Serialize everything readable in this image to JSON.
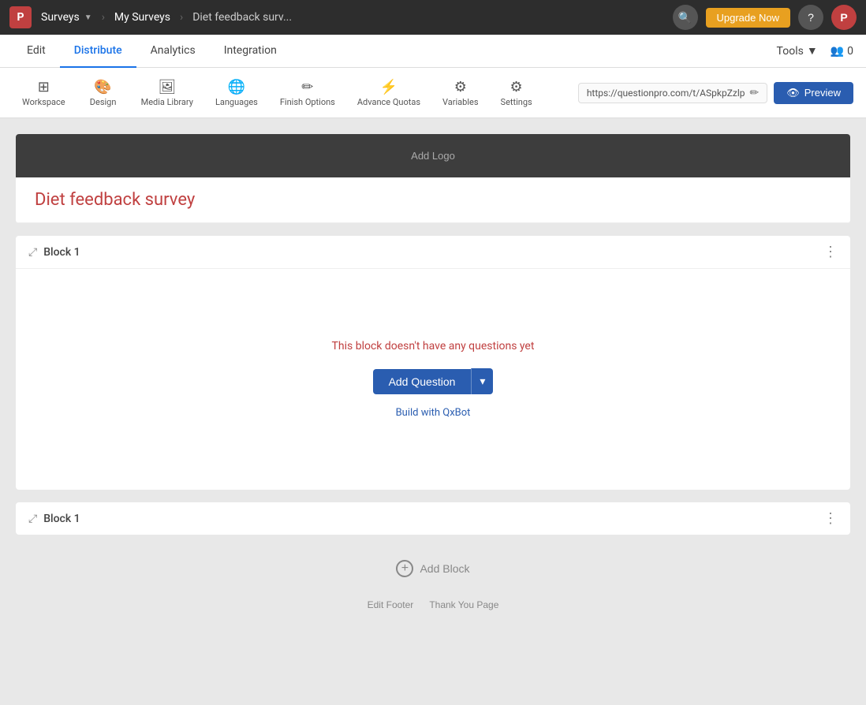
{
  "topbar": {
    "logo_text": "P",
    "surveys_label": "Surveys",
    "breadcrumb_my_surveys": "My Surveys",
    "breadcrumb_survey": "Diet feedback surv...",
    "upgrade_btn": "Upgrade Now",
    "search_icon": "🔍",
    "help_icon": "?",
    "profile_icon": "P"
  },
  "nav": {
    "tabs": [
      "Edit",
      "Distribute",
      "Analytics",
      "Integration"
    ],
    "active_tab": "Distribute",
    "tools_label": "Tools",
    "people_count": "0"
  },
  "toolbar": {
    "items": [
      {
        "label": "Workspace",
        "icon": "⊞"
      },
      {
        "label": "Design",
        "icon": "🎨"
      },
      {
        "label": "Media Library",
        "icon": "🖼"
      },
      {
        "label": "Languages",
        "icon": "🌐"
      },
      {
        "label": "Finish Options",
        "icon": "✏"
      },
      {
        "label": "Advance Quotas",
        "icon": "⚡"
      },
      {
        "label": "Variables",
        "icon": "⚙"
      },
      {
        "label": "Settings",
        "icon": "⚙"
      }
    ],
    "url": "https://questionpro.com/t/ASpkpZzlp",
    "preview_btn": "Preview"
  },
  "survey": {
    "add_logo_text": "Add Logo",
    "title": "Diet feedback survey",
    "blocks": [
      {
        "id": "block1",
        "title": "Block 1",
        "empty_text": "This block doesn't have any questions yet",
        "add_question_btn": "Add Question",
        "build_qxbot_link": "Build with QxBot",
        "collapsed": false
      },
      {
        "id": "block2",
        "title": "Block 1",
        "collapsed": true
      }
    ],
    "add_block_btn": "Add Block",
    "footer_links": [
      "Edit Footer",
      "Thank You Page"
    ]
  }
}
